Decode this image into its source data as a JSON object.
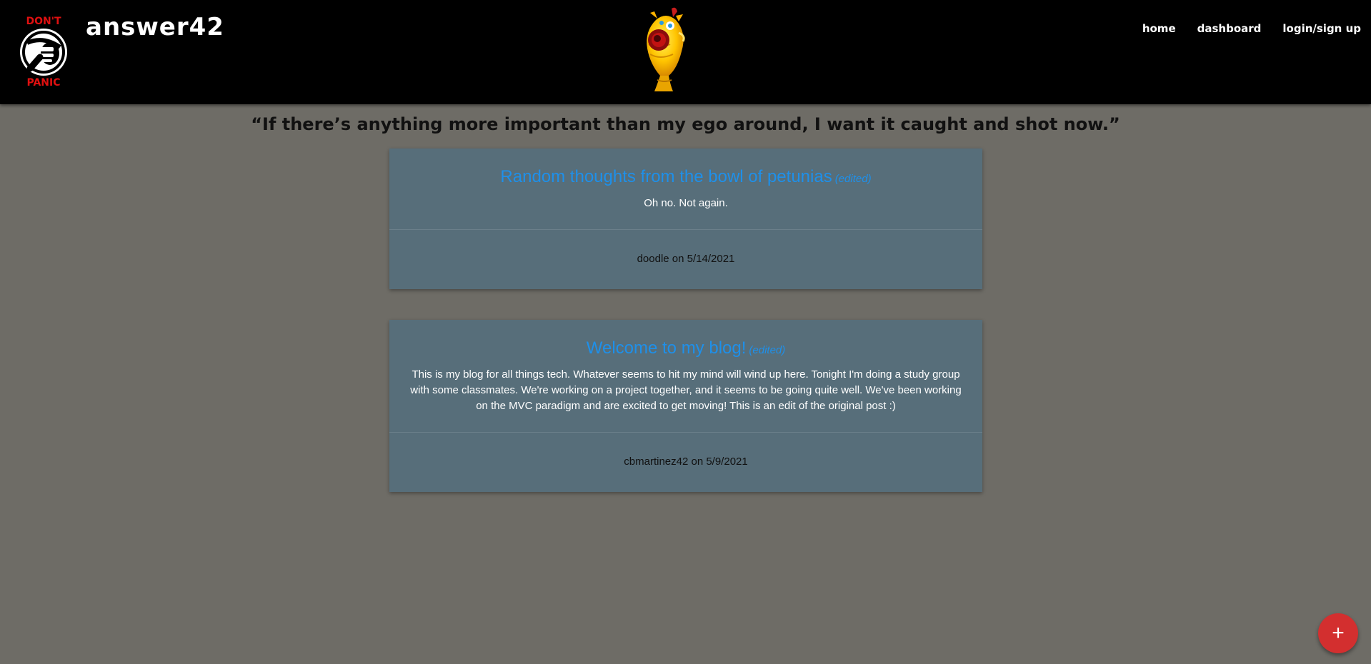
{
  "header": {
    "logo": {
      "top_text": "DON'T",
      "bottom_text": "PANIC"
    },
    "brand": "answer42",
    "mascot_icon": "babel-fish-icon",
    "nav": [
      {
        "label": "home"
      },
      {
        "label": "dashboard"
      },
      {
        "label": "login/sign up"
      }
    ]
  },
  "quote": "“If there’s anything more important than my ego around, I want it caught and shot now.”",
  "posts": [
    {
      "title": "Random thoughts from the bowl of petunias",
      "edited": "(edited)",
      "body": "Oh no. Not again.",
      "meta": "doodle on 5/14/2021"
    },
    {
      "title": "Welcome to my blog!",
      "edited": "(edited)",
      "body": "This is my blog for all things tech. Whatever seems to hit my mind will wind up here. Tonight I'm doing a study group with some classmates. We're working on a project together, and it seems to be going quite well. We've been working on the MVC paradigm and are excited to get moving! This is an edit of the original post :)",
      "meta": "cbmartinez42 on 5/9/2021"
    }
  ],
  "fab": {
    "label": "+",
    "icon": "plus-icon"
  },
  "colors": {
    "header_bg": "#000000",
    "page_bg": "#6e6c66",
    "card_bg": "#576e7a",
    "title_blue": "#1e90ea",
    "fab_red": "#d32f2f",
    "logo_red": "#e01010"
  }
}
